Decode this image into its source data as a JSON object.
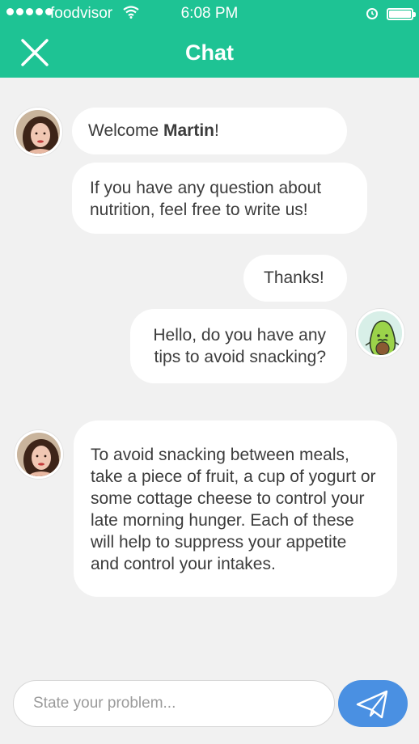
{
  "status_bar": {
    "carrier": "foodvisor",
    "time": "6:08 PM"
  },
  "header": {
    "title": "Chat"
  },
  "messages": [
    {
      "text_prefix": "Welcome ",
      "text_bold": "Martin",
      "text_suffix": "!"
    },
    {
      "lines": [
        "If you have any question about",
        "nutrition, feel free to write us!"
      ]
    },
    {
      "lines": [
        "Thanks!"
      ]
    },
    {
      "lines": [
        "Hello, do you have any",
        "tips to avoid snacking?"
      ]
    },
    {
      "lines": [
        "To avoid snacking between meals,",
        "take a piece of fruit, a cup of yogurt or",
        "some cottage cheese to control your",
        "late morning hunger. Each of these",
        "will help to suppress your appetite",
        "and control your intakes."
      ]
    }
  ],
  "composer": {
    "placeholder": "State your problem..."
  },
  "colors": {
    "brand": "#1ec394",
    "send": "#4a90e2",
    "background": "#f1f1f1"
  },
  "icons": {
    "close": "close-icon",
    "send": "paper-plane-icon",
    "avatar_user": "avocado-icon"
  }
}
